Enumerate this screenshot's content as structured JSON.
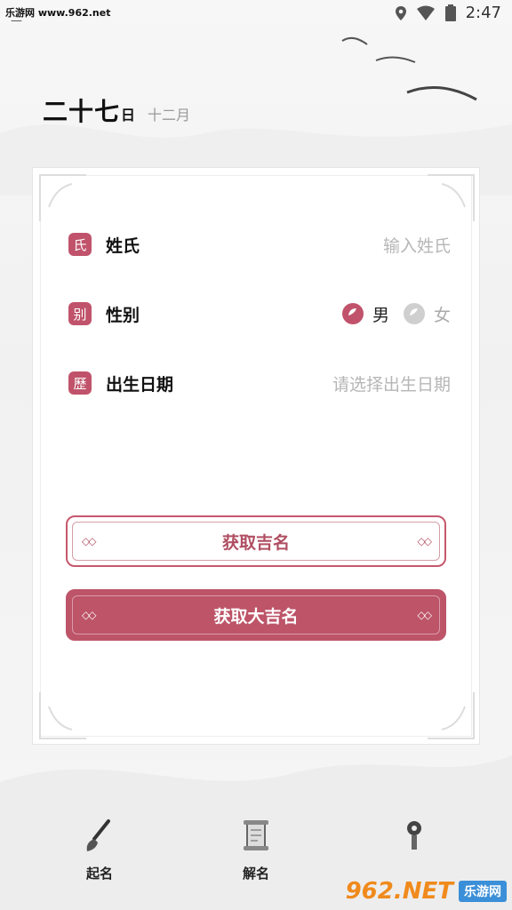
{
  "status": {
    "watermark": "乐游网 www.962.net",
    "dash": "—",
    "time": "2:47"
  },
  "date": {
    "day": "二十七",
    "unit": "日",
    "month": "十二月"
  },
  "form": {
    "surname": {
      "seal": "氏",
      "label": "姓氏",
      "placeholder": "输入姓氏"
    },
    "gender": {
      "seal": "别",
      "label": "性别",
      "male": "男",
      "female": "女",
      "selected": "男"
    },
    "birth": {
      "seal": "歷",
      "label": "出生日期",
      "placeholder": "请选择出生日期"
    }
  },
  "buttons": {
    "lucky": "获取吉名",
    "great_lucky": "获取大吉名",
    "diamonds": "◇◇"
  },
  "nav": {
    "items": [
      {
        "label": "起名",
        "icon": "brush-icon"
      },
      {
        "label": "解名",
        "icon": "scroll-icon"
      },
      {
        "label": "",
        "icon": "lamp-icon"
      }
    ]
  },
  "watermark_bottom": {
    "brand": "962.NET",
    "cn": "乐游网"
  },
  "colors": {
    "accent": "#bd5468",
    "placeholder": "#b6b6b6",
    "background": "#f4f4f4"
  }
}
